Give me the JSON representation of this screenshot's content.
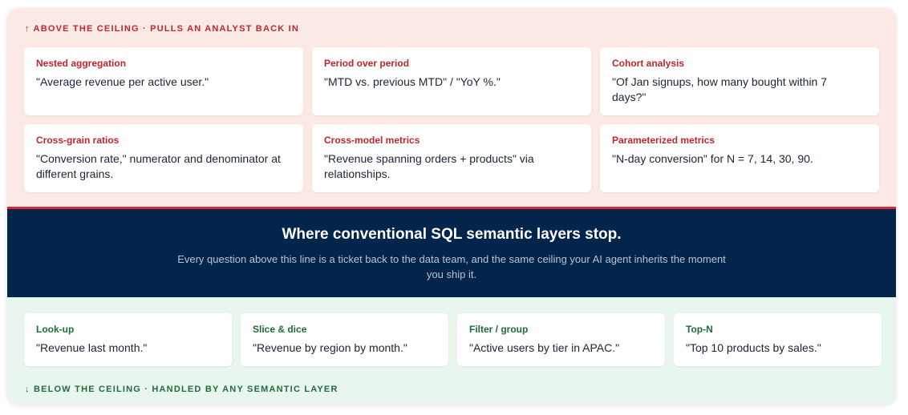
{
  "above": {
    "title": "↑ ABOVE THE CEILING · PULLS AN ANALYST BACK IN",
    "cards": [
      {
        "title": "Nested aggregation",
        "text": "\"Average revenue per active user.\""
      },
      {
        "title": "Period over period",
        "text": "\"MTD vs. previous MTD\" / \"YoY %.\""
      },
      {
        "title": "Cohort analysis",
        "text": "\"Of Jan signups, how many bought within 7 days?\""
      },
      {
        "title": "Cross-grain ratios",
        "text": "\"Conversion rate,\" numerator and denominator at different grains."
      },
      {
        "title": "Cross-model metrics",
        "text": "\"Revenue spanning orders + products\" via relationships."
      },
      {
        "title": "Parameterized metrics",
        "text": "\"N-day conversion\" for N = 7, 14, 30, 90."
      }
    ]
  },
  "band": {
    "title": "Where conventional SQL semantic layers stop.",
    "subtitle": "Every question above this line is a ticket back to the data team, and the same ceiling your AI agent inherits the moment you ship it."
  },
  "below": {
    "title": "↓ BELOW THE CEILING · HANDLED BY ANY SEMANTIC LAYER",
    "cards": [
      {
        "title": "Look-up",
        "text": "\"Revenue last month.\""
      },
      {
        "title": "Slice & dice",
        "text": "\"Revenue by region by month.\""
      },
      {
        "title": "Filter / group",
        "text": "\"Active users by tier in APAC.\""
      },
      {
        "title": "Top-N",
        "text": "\"Top 10 products by sales.\""
      }
    ]
  },
  "colors": {
    "above_bg": "#fbe9e5",
    "accent_red": "#c0262d",
    "band_bg": "#03254c",
    "below_bg": "#e9f6ee",
    "accent_green": "#1e6b3c"
  }
}
